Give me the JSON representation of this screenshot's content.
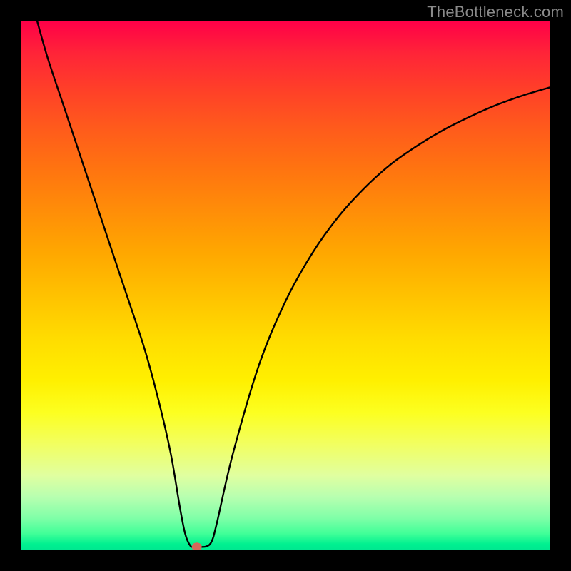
{
  "watermark": "TheBottleneck.com",
  "chart_data": {
    "type": "line",
    "title": "",
    "xlabel": "",
    "ylabel": "",
    "xlim": [
      0,
      100
    ],
    "ylim": [
      0,
      100
    ],
    "series": [
      {
        "name": "curve",
        "x": [
          3,
          5,
          8,
          11,
          14,
          17,
          20,
          23,
          25,
          27,
          28.5,
          30,
          31,
          32,
          33,
          34,
          35,
          36,
          37,
          40,
          45,
          50,
          55,
          60,
          65,
          70,
          75,
          80,
          85,
          90,
          95,
          100
        ],
        "values": [
          100,
          93,
          84,
          75,
          66,
          57,
          48,
          39,
          32,
          24,
          17,
          8,
          3,
          0.7,
          0.5,
          0.5,
          0.6,
          1.5,
          5,
          18,
          35,
          47,
          56,
          63,
          68.5,
          73,
          76.5,
          79.5,
          82,
          84.2,
          86,
          87.5
        ]
      }
    ],
    "marker": {
      "x": 33.2,
      "y": 0.5,
      "color": "#d6675a"
    },
    "gradient_stops": [
      {
        "pct": 0,
        "color": "#ff0048"
      },
      {
        "pct": 50,
        "color": "#ffc200"
      },
      {
        "pct": 80,
        "color": "#f2ff60"
      },
      {
        "pct": 100,
        "color": "#00e890"
      }
    ]
  }
}
